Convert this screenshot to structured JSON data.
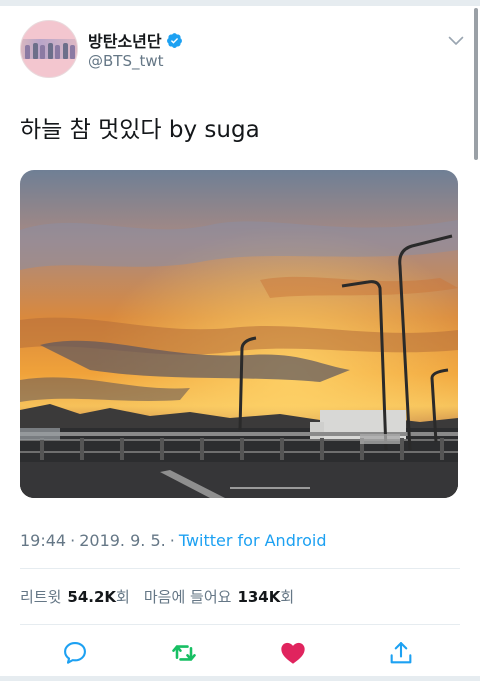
{
  "tweet": {
    "display_name": "방탄소년단",
    "handle": "@BTS_twt",
    "text": "하늘 참 멋있다 by suga",
    "time": "19:44",
    "date": "2019. 9. 5.",
    "separator": "·",
    "source": "Twitter for Android"
  },
  "stats": {
    "retweets_label": "리트윗",
    "retweets_value": "54.2K",
    "retweets_suffix": "회",
    "likes_label": "마음에 들어요",
    "likes_value": "134K",
    "likes_suffix": "회"
  },
  "icons": {
    "verified": "verified-badge-icon",
    "caret": "chevron-down-icon",
    "reply": "reply-icon",
    "retweet": "retweet-icon",
    "like": "heart-icon",
    "share": "share-icon"
  },
  "colors": {
    "accent": "#1da1f2",
    "retweet_active": "#17bf63",
    "like_active": "#e0245e",
    "muted": "#657786"
  }
}
